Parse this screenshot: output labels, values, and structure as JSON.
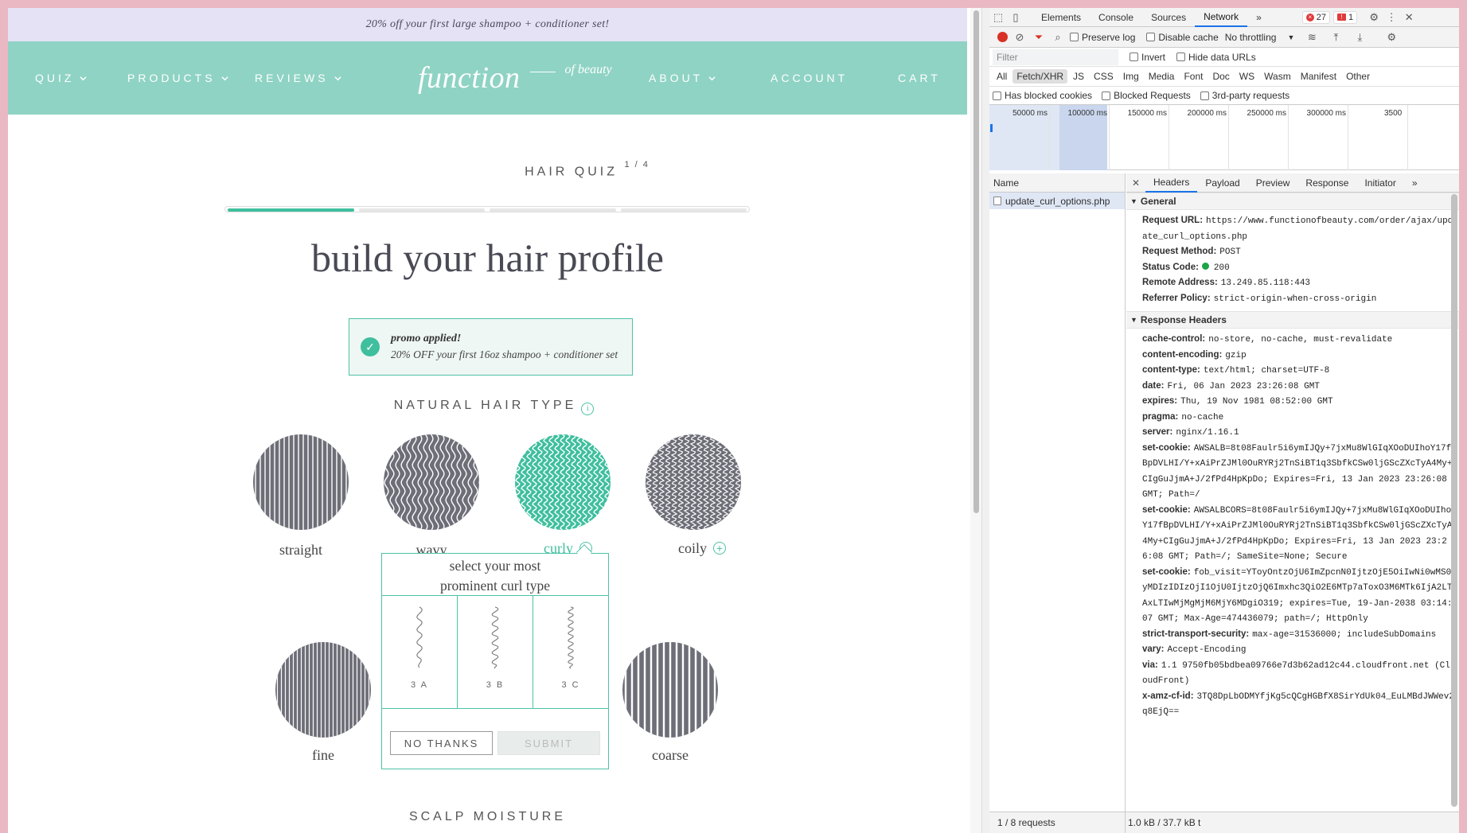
{
  "site": {
    "promo_bar": "20% off your first large shampoo + conditioner set!",
    "nav": {
      "quiz": "QUIZ",
      "products": "PRODUCTS",
      "reviews": "REVIEWS",
      "logo_main": "function",
      "logo_sub": "of beauty",
      "about": "ABOUT",
      "account": "ACCOUNT",
      "cart": "CART"
    },
    "quiz_title": "HAIR QUIZ",
    "quiz_step": "1 / 4",
    "progress_steps": 4,
    "progress_current": 1,
    "heading": "build your hair profile",
    "promo": {
      "title": "promo applied!",
      "text": "20% OFF your first 16oz shampoo + conditioner set"
    },
    "natural_hair_type_label": "NATURAL HAIR TYPE",
    "info_icon": "i",
    "hair_types": [
      "straight",
      "wavy",
      "curly",
      "coily"
    ],
    "selected_hair_type": "curly",
    "textures": [
      "fine",
      "coarse"
    ],
    "curl_popup": {
      "title_line1": "select your most",
      "title_line2": "prominent curl type",
      "options": [
        "3 A",
        "3 B",
        "3 C"
      ],
      "no_thanks": "NO THANKS",
      "submit": "SUBMIT"
    },
    "scalp_moisture_label": "SCALP MOISTURE",
    "accent_color": "#3fbf9e",
    "nav_color": "#8fd3c4"
  },
  "devtools": {
    "tabs": [
      "Elements",
      "Console",
      "Sources",
      "Network"
    ],
    "active_tab": "Network",
    "more_tabs": "»",
    "errors_count": "27",
    "issues_count": "1",
    "toolbar": {
      "preserve_log": "Preserve log",
      "disable_cache": "Disable cache",
      "throttling": "No throttling"
    },
    "filter_placeholder": "Filter",
    "invert": "Invert",
    "hide_data_urls": "Hide data URLs",
    "types": [
      "All",
      "Fetch/XHR",
      "JS",
      "CSS",
      "Img",
      "Media",
      "Font",
      "Doc",
      "WS",
      "Wasm",
      "Manifest",
      "Other"
    ],
    "active_type": "Fetch/XHR",
    "blocked": {
      "has_blocked_cookies": "Has blocked cookies",
      "blocked_requests": "Blocked Requests",
      "third_party": "3rd-party requests"
    },
    "timeline_ticks": [
      "50000 ms",
      "100000 ms",
      "150000 ms",
      "200000 ms",
      "250000 ms",
      "300000 ms",
      "3500"
    ],
    "name_header": "Name",
    "request_name": "update_curl_options.php",
    "detail_tabs": [
      "Headers",
      "Payload",
      "Preview",
      "Response",
      "Initiator"
    ],
    "active_detail_tab": "Headers",
    "general_title": "General",
    "general": [
      {
        "k": "Request URL:",
        "v": "https://www.functionofbeauty.com/order/ajax/update_curl_options.php"
      },
      {
        "k": "Request Method:",
        "v": "POST"
      },
      {
        "k": "Status Code:",
        "v": "200"
      },
      {
        "k": "Remote Address:",
        "v": "13.249.85.118:443"
      },
      {
        "k": "Referrer Policy:",
        "v": "strict-origin-when-cross-origin"
      }
    ],
    "response_title": "Response Headers",
    "response_headers": [
      {
        "k": "cache-control:",
        "v": "no-store, no-cache, must-revalidate"
      },
      {
        "k": "content-encoding:",
        "v": "gzip"
      },
      {
        "k": "content-type:",
        "v": "text/html; charset=UTF-8"
      },
      {
        "k": "date:",
        "v": "Fri, 06 Jan 2023 23:26:08 GMT"
      },
      {
        "k": "expires:",
        "v": "Thu, 19 Nov 1981 08:52:00 GMT"
      },
      {
        "k": "pragma:",
        "v": "no-cache"
      },
      {
        "k": "server:",
        "v": "nginx/1.16.1"
      },
      {
        "k": "set-cookie:",
        "v": "AWSALB=8t08Faulr5i6ymIJQy+7jxMu8WlGIqXOoDUIhoY17fBpDVLHI/Y+xAiPrZJMl0OuRYRj2TnSiBT1q3SbfkCSw0ljGScZXcTyA4My+CIgGuJjmA+J/2fPd4HpKpDo; Expires=Fri, 13 Jan 2023 23:26:08 GMT; Path=/"
      },
      {
        "k": "set-cookie:",
        "v": "AWSALBCORS=8t08Faulr5i6ymIJQy+7jxMu8WlGIqXOoDUIhoY17fBpDVLHI/Y+xAiPrZJMl0OuRYRj2TnSiBT1q3SbfkCSw0ljGScZXcTyA4My+CIgGuJjmA+J/2fPd4HpKpDo; Expires=Fri, 13 Jan 2023 23:26:08 GMT; Path=/; SameSite=None; Secure"
      },
      {
        "k": "set-cookie:",
        "v": "fob_visit=YToyOntzOjU6ImZpcnN0IjtzOjE5OiIwNi0wMS0yMDIzIDIzOjI1OjU0IjtzOjQ6Imxhc3QiO2E6MTp7aToxO3M6MTk6IjA2LTAxLTIwMjMgMjM6MjY6MDgiO319; expires=Tue, 19-Jan-2038 03:14:07 GMT; Max-Age=474436079; path=/; HttpOnly"
      },
      {
        "k": "strict-transport-security:",
        "v": "max-age=31536000; includeSubDomains"
      },
      {
        "k": "vary:",
        "v": "Accept-Encoding"
      },
      {
        "k": "via:",
        "v": "1.1 9750fb05bdbea09766e7d3b62ad12c44.cloudfront.net (CloudFront)"
      },
      {
        "k": "x-amz-cf-id:",
        "v": "3TQ8DpLbODMYfjKg5cQCgHGBfX8SirYdUk04_EuLMBdJWWev2q8EjQ=="
      }
    ],
    "status_requests": "1 / 8 requests",
    "status_size": "1.0 kB / 37.7 kB t"
  }
}
